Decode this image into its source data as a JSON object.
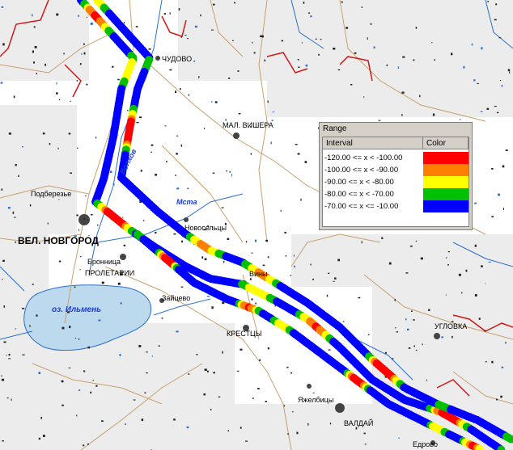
{
  "map": {
    "labels": {
      "chudovo": "ЧУДОВО",
      "mal_vishera": "МАЛ. ВИШЕРА",
      "podberezye": "Подберезье",
      "vel_novgorod": "ВЕЛ. НОВГОРОД",
      "novoseltsy": "Новосельцы",
      "bronnitsa": "Бронница",
      "proletarii": "ПРОЛЕТАРИИ",
      "viny": "Вины",
      "zaytsevo": "Зайцево",
      "kresttsy": "КРЕСТЦЫ",
      "uglovka": "УГЛОВКА",
      "yazhelbitsy": "Яжелбицы",
      "valday": "ВАЛДАЙ",
      "edrovo": "Едрово"
    },
    "water_labels": {
      "volkhov": "Волхов",
      "msta": "Мста",
      "ilmen": "оз. Ильмень"
    },
    "colors": {
      "land": "#ffffff",
      "grey_tiles": "#ececec",
      "roads": "#c8a06e",
      "boundary": "#d01818",
      "rivers": "#2a6fcf",
      "lake": "#bcd9ee"
    }
  },
  "legend": {
    "title": "Range",
    "col_interval": "Interval",
    "col_color": "Color",
    "rows": [
      {
        "label": "-120.00 <= x < -100.00",
        "color": "#ff0000"
      },
      {
        "label": "-100.00 <= x < -90.00",
        "color": "#ff8000"
      },
      {
        "label": "-90.00 <= x < -80.00",
        "color": "#ffff00"
      },
      {
        "label": "-80.00 <= x < -70.00",
        "color": "#00c000"
      },
      {
        "label": "-70.00 <= x <= -10.00",
        "color": "#0000ff"
      }
    ]
  }
}
